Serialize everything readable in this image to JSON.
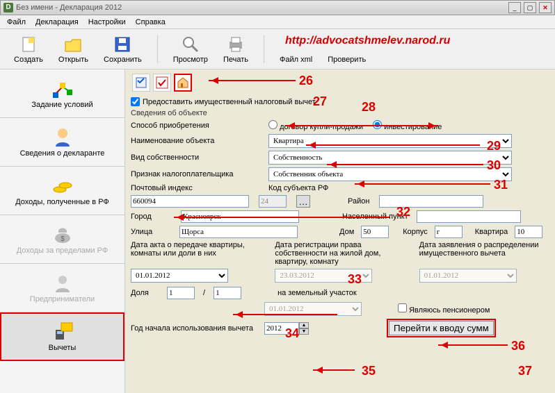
{
  "window": {
    "title": "Без имени - Декларация 2012"
  },
  "menu": {
    "file": "Файл",
    "declaration": "Декларация",
    "settings": "Настройки",
    "help": "Справка"
  },
  "toolbar": {
    "create": "Создать",
    "open": "Открыть",
    "save": "Сохранить",
    "preview": "Просмотр",
    "print": "Печать",
    "xml": "Файл xml",
    "check": "Проверить"
  },
  "watermark": "http://advocatshmelev.narod.ru",
  "sidebar": {
    "conditions": "Задание условий",
    "declarant": "Сведения о декларанте",
    "income_rf": "Доходы, полученные в РФ",
    "income_abroad": "Доходы за пределами РФ",
    "entrepreneur": "Предприниматели",
    "deductions": "Вычеты"
  },
  "form": {
    "provide_checkbox": "Предоставить имущественный налоговый вычет",
    "object_info": "Сведения об объекте",
    "acquisition_method": "Способ приобретения",
    "radio_contract": "договор купли-продажи",
    "radio_invest": "инвестирование",
    "object_name_label": "Наименование объекта",
    "object_name_value": "Квартира",
    "ownership_label": "Вид собственности",
    "ownership_value": "Собственность",
    "taxpayer_label": "Признак налогоплательщика",
    "taxpayer_value": "Собственник объекта",
    "postcode_label": "Почтовый индекс",
    "postcode_value": "660094",
    "region_code_label": "Код субъекта РФ",
    "region_code_value": "24",
    "district_label": "Район",
    "district_value": "",
    "city_label": "Город",
    "city_value": "Красноярск",
    "locality_label": "Населенный пункт",
    "locality_value": "",
    "street_label": "Улица",
    "street_value": "Щорса",
    "house_label": "Дом",
    "house_value": "50",
    "building_label": "Корпус",
    "building_value": "г",
    "flat_label": "Квартира",
    "flat_value": "10",
    "date_act_label": "Дата акта о передаче квартиры, комнаты или доли в них",
    "date_act_value": "01.01.2012",
    "date_reg_label": "Дата регистрации права собственности на жилой дом, квартиру, комнату",
    "date_reg_value": "23.03.2012",
    "date_app_label": "Дата заявления о распределении имущественного вычета",
    "date_app_value": "01.01.2012",
    "land_label": "на земельный участок",
    "land_value": "01.01.2012",
    "share_label": "Доля",
    "share_num": "1",
    "share_den": "1",
    "pensioner_label": "Являюсь пенсионером",
    "year_label": "Год начала использования вычета",
    "year_value": "2012",
    "goto_sums": "Перейти к вводу сумм"
  },
  "annotations": {
    "n26": "26",
    "n27": "27",
    "n28": "28",
    "n29": "29",
    "n30": "30",
    "n31": "31",
    "n32": "32",
    "n33": "33",
    "n34": "34",
    "n35": "35",
    "n36": "36",
    "n37": "37"
  }
}
